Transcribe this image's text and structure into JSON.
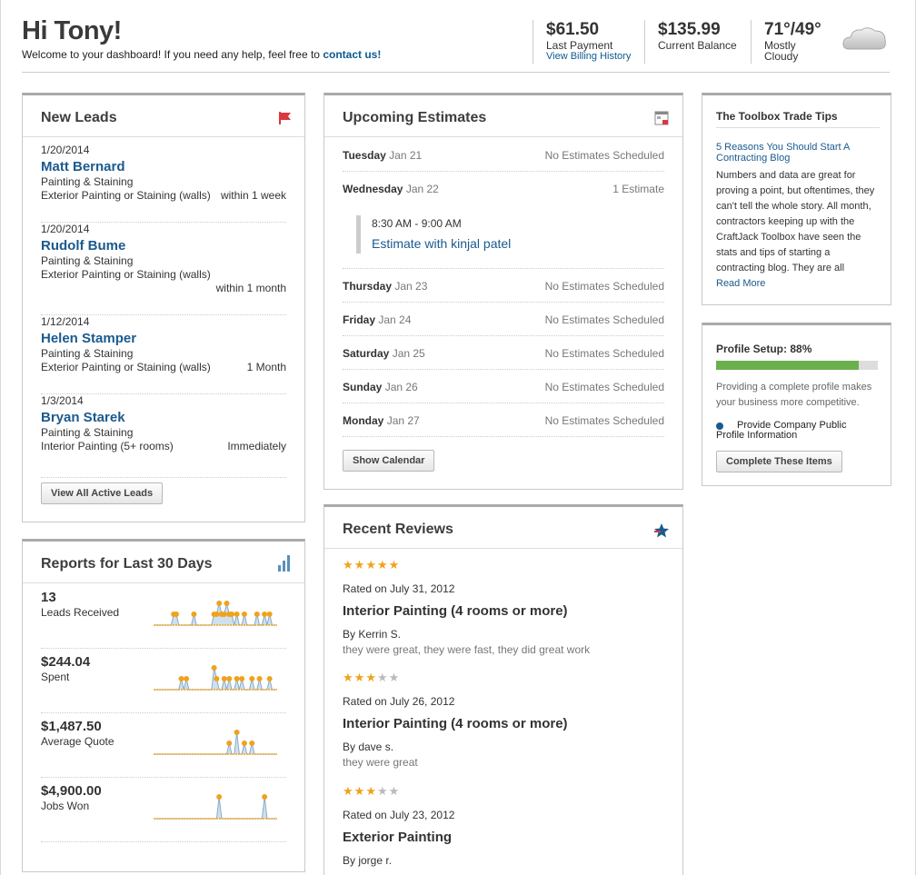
{
  "header": {
    "greeting": "Hi Tony!",
    "welcome_text": "Welcome to your dashboard! If you need any help, feel free to",
    "contact_link": "contact us!",
    "last_payment": {
      "value": "$61.50",
      "label": "Last Payment",
      "link": "View Billing History"
    },
    "balance": {
      "value": "$135.99",
      "label": "Current Balance"
    },
    "weather": {
      "temp": "71°/49°",
      "line1": "Mostly",
      "line2": "Cloudy",
      "icon": "cloud-icon"
    }
  },
  "new_leads": {
    "title": "New Leads",
    "icon": "flag-icon",
    "items": [
      {
        "date": "1/20/2014",
        "name": "Matt Bernard",
        "service": "Painting & Staining",
        "detail": "Exterior Painting or Staining (walls)",
        "timing": "within 1 week"
      },
      {
        "date": "1/20/2014",
        "name": "Rudolf Bume",
        "service": "Painting & Staining",
        "detail": "Exterior Painting or Staining (walls)",
        "timing": "within 1 month"
      },
      {
        "date": "1/12/2014",
        "name": "Helen Stamper",
        "service": "Painting & Staining",
        "detail": "Exterior Painting or Staining (walls)",
        "timing": "1 Month"
      },
      {
        "date": "1/3/2014",
        "name": "Bryan Starek",
        "service": "Painting & Staining",
        "detail": "Interior Painting (5+ rooms)",
        "timing": "Immediately"
      }
    ],
    "button": "View All Active Leads"
  },
  "reports": {
    "title": "Reports for Last 30 Days",
    "icon": "bar-chart-icon",
    "items": [
      {
        "value": "13",
        "label": "Leads Received"
      },
      {
        "value": "$244.04",
        "label": "Spent"
      },
      {
        "value": "$1,487.50",
        "label": "Average Quote"
      },
      {
        "value": "$4,900.00",
        "label": "Jobs Won"
      }
    ],
    "sparklines": [
      [
        0,
        0,
        0,
        0,
        0,
        0,
        0,
        0,
        1,
        1,
        0,
        0,
        0,
        0,
        0,
        0,
        1,
        0,
        0,
        0,
        0,
        0,
        0,
        0,
        1,
        1,
        2,
        1,
        1,
        2,
        1,
        1,
        0,
        1,
        0,
        0,
        1,
        0,
        0,
        0,
        0,
        1,
        0,
        0,
        1,
        0,
        1,
        0,
        0,
        0
      ],
      [
        0,
        0,
        0,
        0,
        0,
        0,
        0,
        0,
        0,
        0,
        0,
        1,
        0,
        1,
        0,
        0,
        0,
        0,
        0,
        0,
        0,
        0,
        0,
        0,
        2,
        1,
        0,
        0,
        1,
        0,
        1,
        0,
        0,
        1,
        0,
        1,
        0,
        0,
        0,
        1,
        0,
        0,
        1,
        0,
        0,
        0,
        1,
        0,
        0,
        0
      ],
      [
        0,
        0,
        0,
        0,
        0,
        0,
        0,
        0,
        0,
        0,
        0,
        0,
        0,
        0,
        0,
        0,
        0,
        0,
        0,
        0,
        0,
        0,
        0,
        0,
        0,
        0,
        0,
        0,
        0,
        0,
        1,
        0,
        0,
        2,
        0,
        0,
        1,
        0,
        0,
        1,
        0,
        0,
        0,
        0,
        0,
        0,
        0,
        0,
        0,
        0
      ],
      [
        0,
        0,
        0,
        0,
        0,
        0,
        0,
        0,
        0,
        0,
        0,
        0,
        0,
        0,
        0,
        0,
        0,
        0,
        0,
        0,
        0,
        0,
        0,
        0,
        0,
        0,
        2,
        0,
        0,
        0,
        0,
        0,
        0,
        0,
        0,
        0,
        0,
        0,
        0,
        0,
        0,
        0,
        0,
        0,
        2,
        0,
        0,
        0,
        0,
        0
      ]
    ]
  },
  "estimates": {
    "title": "Upcoming Estimates",
    "icon": "calendar-icon",
    "days": [
      {
        "day": "Tuesday",
        "date": "Jan 21",
        "status": "No Estimates Scheduled"
      },
      {
        "day": "Wednesday",
        "date": "Jan 22",
        "status": "1 Estimate"
      },
      {
        "day": "Thursday",
        "date": "Jan 23",
        "status": "No Estimates Scheduled"
      },
      {
        "day": "Friday",
        "date": "Jan 24",
        "status": "No Estimates Scheduled"
      },
      {
        "day": "Saturday",
        "date": "Jan 25",
        "status": "No Estimates Scheduled"
      },
      {
        "day": "Sunday",
        "date": "Jan 26",
        "status": "No Estimates Scheduled"
      },
      {
        "day": "Monday",
        "date": "Jan 27",
        "status": "No Estimates Scheduled"
      }
    ],
    "scheduled": {
      "time": "8:30 AM - 9:00 AM",
      "link": "Estimate with kinjal patel"
    },
    "button": "Show Calendar"
  },
  "reviews": {
    "title": "Recent Reviews",
    "icon": "star-icon",
    "items": [
      {
        "stars": 5,
        "rated": "Rated on July 31, 2012",
        "title": "Interior Painting (4 rooms or more)",
        "by": "By Kerrin S.",
        "comment": "they were great, they were fast, they did great work"
      },
      {
        "stars": 3,
        "rated": "Rated on July 26, 2012",
        "title": "Interior Painting (4 rooms or more)",
        "by": "By dave s.",
        "comment": "they were great"
      },
      {
        "stars": 3,
        "rated": "Rated on July 23, 2012",
        "title": "Exterior Painting",
        "by": "By jorge r.",
        "comment": ""
      }
    ]
  },
  "tips": {
    "title": "The Toolbox Trade Tips",
    "link": "5 Reasons You Should Start A Contracting Blog",
    "body": "Numbers and data are great for proving a point, but oftentimes, they can't tell the whole story. All month, contractors keeping up with the CraftJack Toolbox have seen the stats and tips of starting a contracting blog. They are all",
    "read_more": "Read More"
  },
  "profile": {
    "title": "Profile Setup: 88%",
    "progress": 0.88,
    "text": "Providing a complete profile makes your business more competitive.",
    "item": "Provide Company Public Profile Information",
    "button": "Complete These Items"
  },
  "colors": {
    "link": "#1a5a8e",
    "accent_orange": "#f0a21b",
    "progress_green": "#6ab04c",
    "flag_red": "#d9393e"
  }
}
